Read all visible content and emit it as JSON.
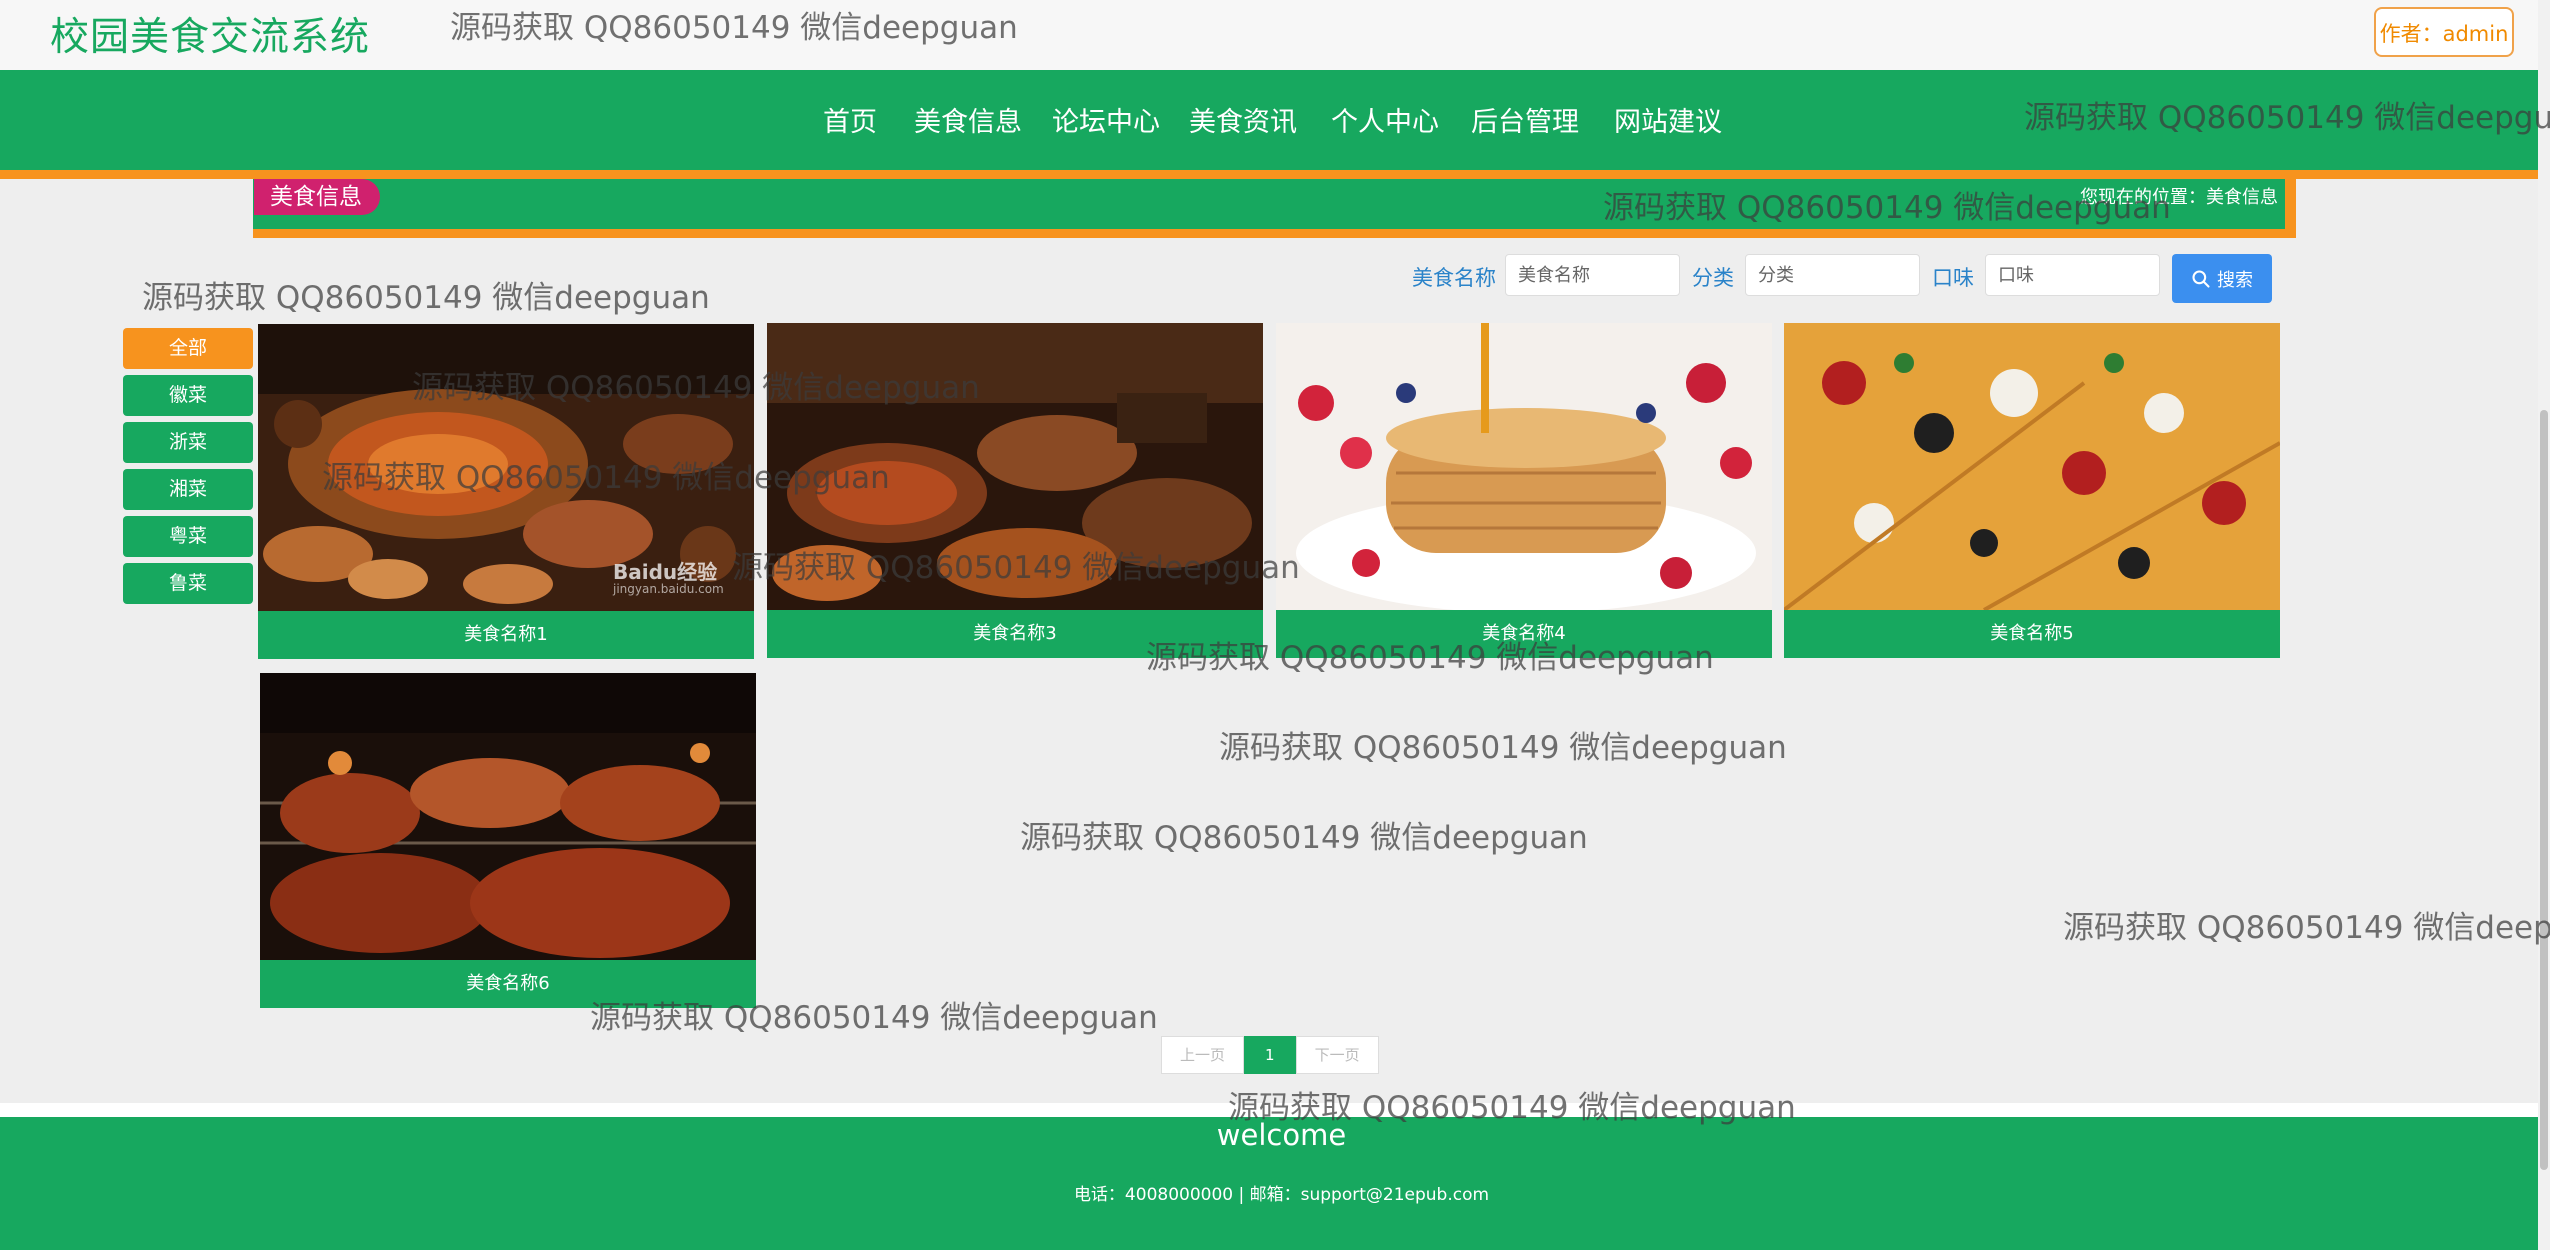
{
  "header": {
    "site_title": "校园美食交流系统",
    "author_label": "作者：admin"
  },
  "nav": {
    "items": [
      "首页",
      "美食信息",
      "论坛中心",
      "美食资讯",
      "个人中心",
      "后台管理",
      "网站建议"
    ]
  },
  "section": {
    "tag": "美食信息",
    "location": "您现在的位置：美食信息"
  },
  "search": {
    "name_label": "美食名称",
    "name_placeholder": "美食名称",
    "category_label": "分类",
    "category_placeholder": "分类",
    "taste_label": "口味",
    "taste_placeholder": "口味",
    "button_label": "搜索"
  },
  "categories": [
    "全部",
    "徽菜",
    "浙菜",
    "湘菜",
    "粤菜",
    "鲁菜"
  ],
  "foods": [
    {
      "name": "美食名称1",
      "image": "hotpot-feast-photo"
    },
    {
      "name": "美食名称3",
      "image": "grilled-dishes-photo"
    },
    {
      "name": "美食名称4",
      "image": "pancake-stack-photo"
    },
    {
      "name": "美食名称5",
      "image": "pizza-photo"
    },
    {
      "name": "美食名称6",
      "image": "bbq-meat-photo"
    }
  ],
  "image_marks": {
    "baidu_logo": "Baidu经验",
    "baidu_url": "jingyan.baidu.com"
  },
  "pagination": {
    "prev": "上一页",
    "current": "1",
    "next": "下一页"
  },
  "footer": {
    "welcome": "welcome",
    "contact": "电话：4008000000 | 邮箱：support@21epub.com"
  },
  "watermark": "源码获取 QQ86050149 微信deepguan",
  "colors": {
    "primary_green": "#17a85f",
    "accent_orange": "#f7931e",
    "tag_pink": "#d0216e",
    "search_blue": "#3b8fef"
  }
}
